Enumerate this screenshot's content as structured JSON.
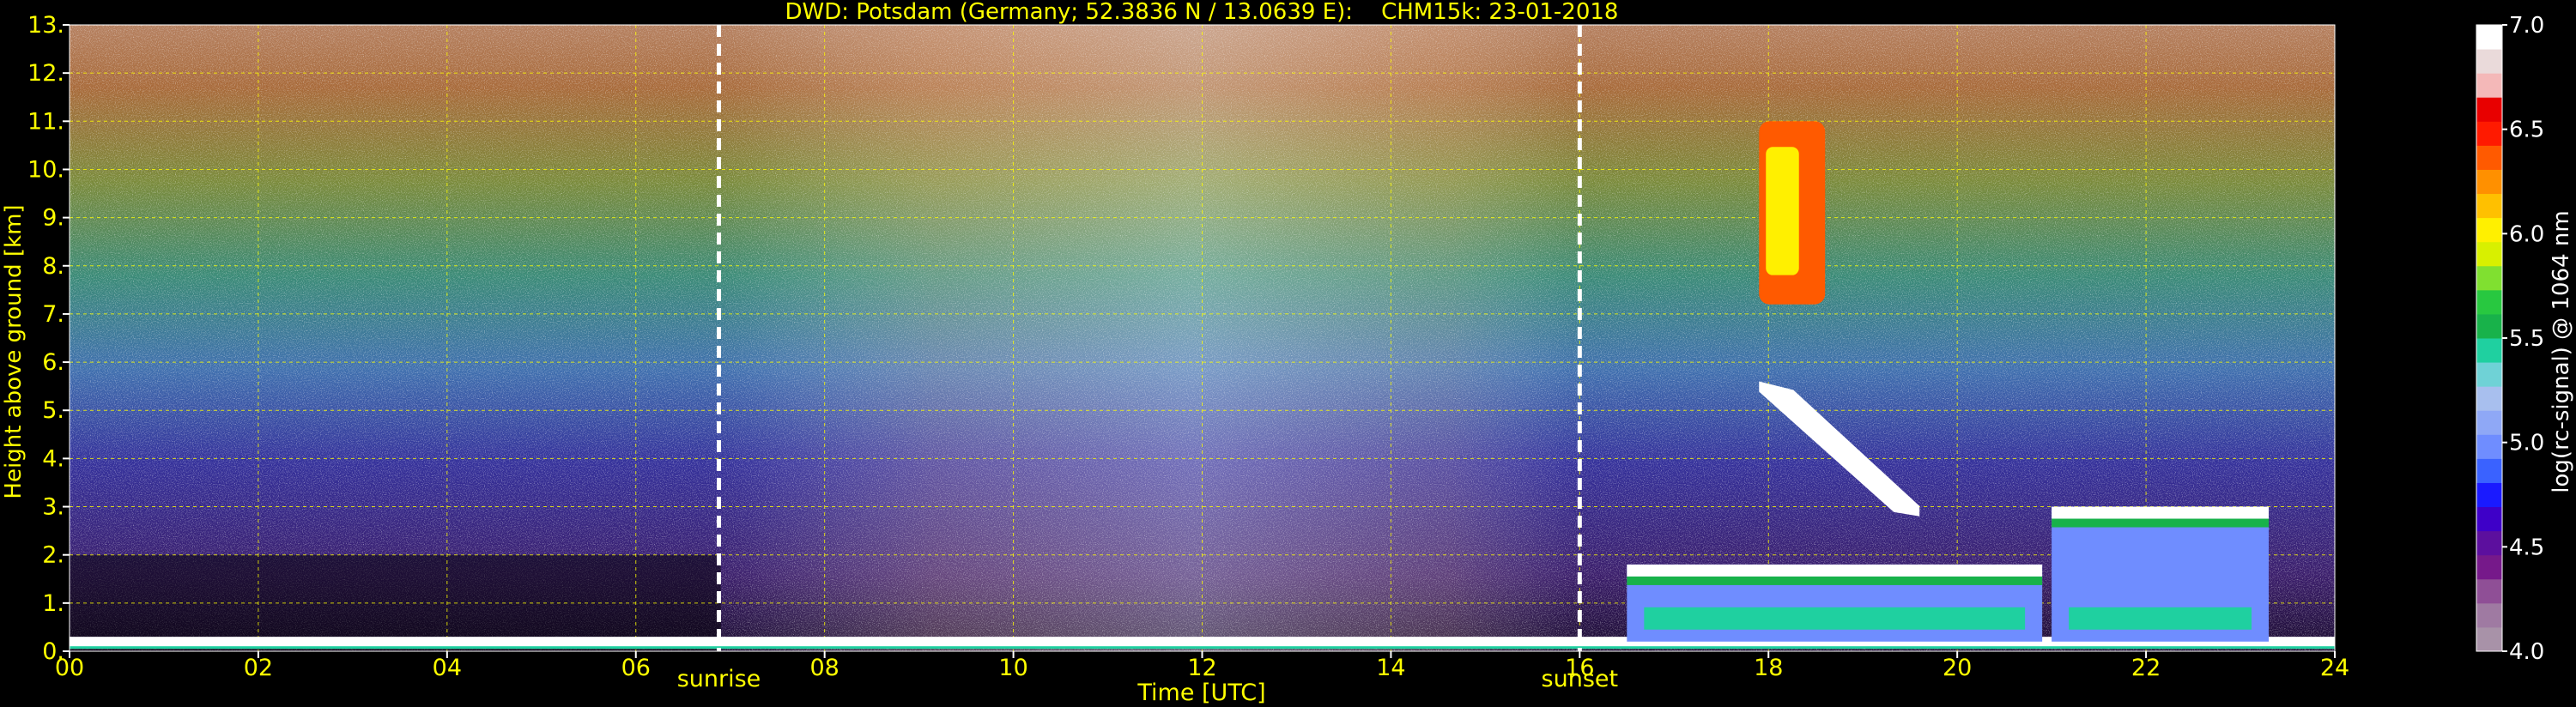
{
  "chart_data": {
    "type": "heatmap",
    "title": "DWD: Potsdam (Germany; 52.3836 N / 13.0639 E):    CHM15k: 23-01-2018",
    "xlabel": "Time [UTC]",
    "ylabel": "Height above ground [km]",
    "xlim": [
      0,
      24
    ],
    "ylim": [
      0,
      13
    ],
    "x_ticks": [
      "00",
      "02",
      "04",
      "06",
      "08",
      "10",
      "12",
      "14",
      "16",
      "18",
      "20",
      "22",
      "24"
    ],
    "y_ticks": [
      "0.",
      "1.",
      "2.",
      "3.",
      "4.",
      "5.",
      "6.",
      "7.",
      "8.",
      "9.",
      "10.",
      "11.",
      "12.",
      "13."
    ],
    "grid": true,
    "markers": [
      {
        "label": "sunrise",
        "x": 6.88
      },
      {
        "label": "sunset",
        "x": 16.0
      }
    ],
    "colorbar": {
      "label": "log(rc-signal) @ 1064 nm",
      "range": [
        4.0,
        7.0
      ],
      "ticks": [
        "4.0",
        "4.5",
        "5.0",
        "5.5",
        "6.0",
        "6.5",
        "7.0"
      ],
      "colors": [
        "#a892a8",
        "#9f7aa2",
        "#8f4f96",
        "#76198a",
        "#5c0f9e",
        "#3e00c8",
        "#1a1aff",
        "#3a62ff",
        "#6f8dff",
        "#8fa8f6",
        "#a8bfee",
        "#6fd2d6",
        "#1fd0a0",
        "#18b24a",
        "#28c840",
        "#80e030",
        "#d8f000",
        "#fff000",
        "#ffc000",
        "#ff9000",
        "#ff5a00",
        "#ff1a00",
        "#e80000",
        "#f4b8b8",
        "#eadada",
        "#ffffff"
      ]
    },
    "features": [
      {
        "type": "surface_layer",
        "x": [
          0,
          24
        ],
        "y": [
          0.05,
          0.3
        ]
      },
      {
        "type": "cirrus",
        "x": [
          17.9,
          18.6
        ],
        "y": [
          7.2,
          11.0
        ]
      },
      {
        "type": "descending_layer",
        "x": [
          17.9,
          19.6
        ],
        "y": [
          2.8,
          5.6
        ]
      },
      {
        "type": "low_cloud",
        "x": [
          16.5,
          20.9
        ],
        "y": [
          0.2,
          1.8
        ]
      },
      {
        "type": "low_cloud",
        "x": [
          21.0,
          23.3
        ],
        "y": [
          0.2,
          3.0
        ]
      }
    ]
  }
}
